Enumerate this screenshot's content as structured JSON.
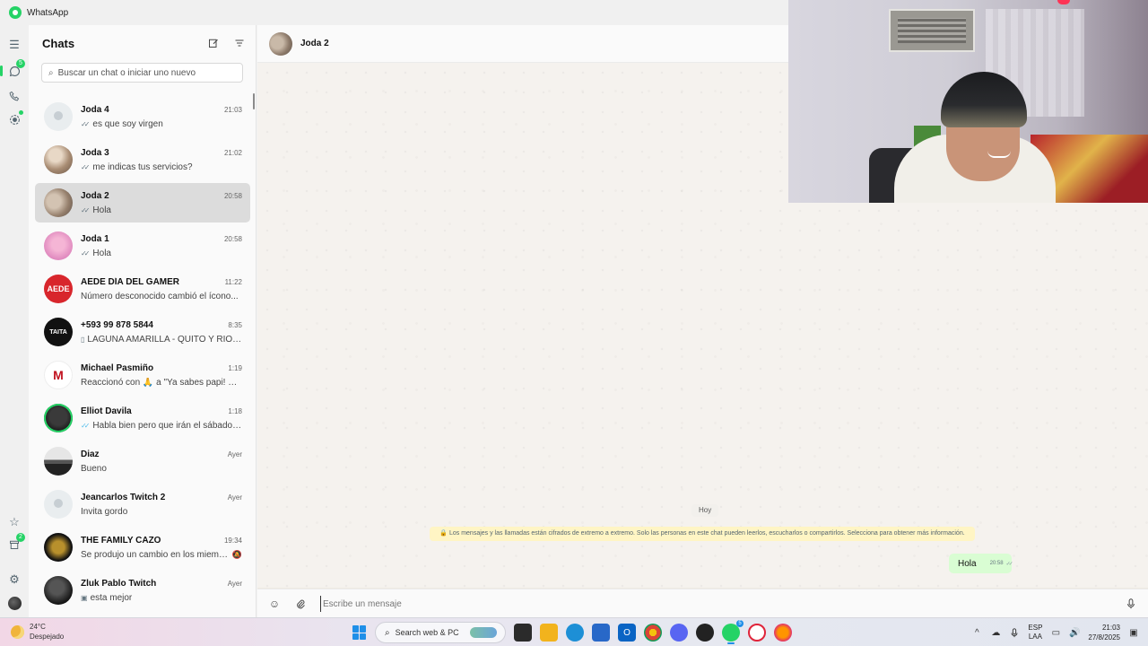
{
  "window": {
    "title": "WhatsApp"
  },
  "rail": {
    "chats_badge": "5",
    "status_badge": "2"
  },
  "sidebar": {
    "title": "Chats",
    "search_placeholder": "Buscar un chat o iniciar uno nuevo"
  },
  "chats": [
    {
      "name": "Joda 4",
      "time": "21:03",
      "tick": "✓✓",
      "message": "es que soy virgen",
      "avatar": "placeholder"
    },
    {
      "name": "Joda 3",
      "time": "21:02",
      "tick": "✓✓",
      "message": "me indicas tus servicios?",
      "avatar": "photo"
    },
    {
      "name": "Joda 2",
      "time": "20:58",
      "tick": "✓✓",
      "message": "Hola",
      "avatar": "photo",
      "selected": true
    },
    {
      "name": "Joda 1",
      "time": "20:58",
      "tick": "✓✓",
      "message": "Hola",
      "avatar": "pink"
    },
    {
      "name": "AEDE DÍA DEL GAMER",
      "time": "11:22",
      "message": "Número desconocido cambió el ícono...",
      "avatar": "aede",
      "avatar_text": "AEDE"
    },
    {
      "name": "+593 99 878 5844",
      "time": "8:35",
      "doc_icon": "document-icon",
      "message": "LAGUNA AMARILLA - QUITO Y RIOB...",
      "avatar": "taita",
      "avatar_text": "TAITA"
    },
    {
      "name": "Michael Pasmiño",
      "time": "1:19",
      "message": "Reaccionó con 🙏 a \"Ya sabes papi! Gra...",
      "avatar": "m",
      "avatar_text": "M"
    },
    {
      "name": "Elliot Davila",
      "time": "1:18",
      "tick": "✓✓",
      "tick_color": "blue",
      "message": "Habla bien pero que irán el sábado ...",
      "avatar": "elliot"
    },
    {
      "name": "Diaz",
      "time": "Ayer",
      "message": "Bueno",
      "avatar": "diaz"
    },
    {
      "name": "Jeancarlos Twitch 2",
      "time": "Ayer",
      "message": "Invita gordo",
      "avatar": "placeholder"
    },
    {
      "name": "THE FAMILY CAZO",
      "time": "19:34",
      "message": "Se produjo un cambio en los miembro...",
      "avatar": "family",
      "muted": true
    },
    {
      "name": "Zluk Pablo Twitch",
      "time": "Ayer",
      "image_icon": "image-icon",
      "message": "esta mejor",
      "avatar": "zluk"
    }
  ],
  "conversation": {
    "contact_name": "Joda 2",
    "date_chip": "Hoy",
    "encryption_note": "🔒 Los mensajes y las llamadas están cifrados de extremo a extremo. Solo las personas en este chat pueden leerlos, escucharlos o compartirlos. Selecciona para obtener más información.",
    "messages": [
      {
        "text": "Hola",
        "time": "20:58",
        "tick": "✓✓",
        "outgoing": true
      }
    ],
    "composer_placeholder": "Escribe un mensaje"
  },
  "taskbar": {
    "weather_temp": "24°C",
    "weather_desc": "Despejado",
    "search_label": "Search web & PC",
    "whatsapp_badge": "5",
    "lang_top": "ESP",
    "lang_bottom": "LAA",
    "clock_time": "21:03",
    "clock_date": "27/8/2025"
  },
  "colors": {
    "accent": "#25d366",
    "selected_row": "#dcdcdc",
    "outgoing_bubble": "#d9fdd3",
    "encryption_bg": "#fff5c4",
    "read_tick": "#53bdeb"
  }
}
